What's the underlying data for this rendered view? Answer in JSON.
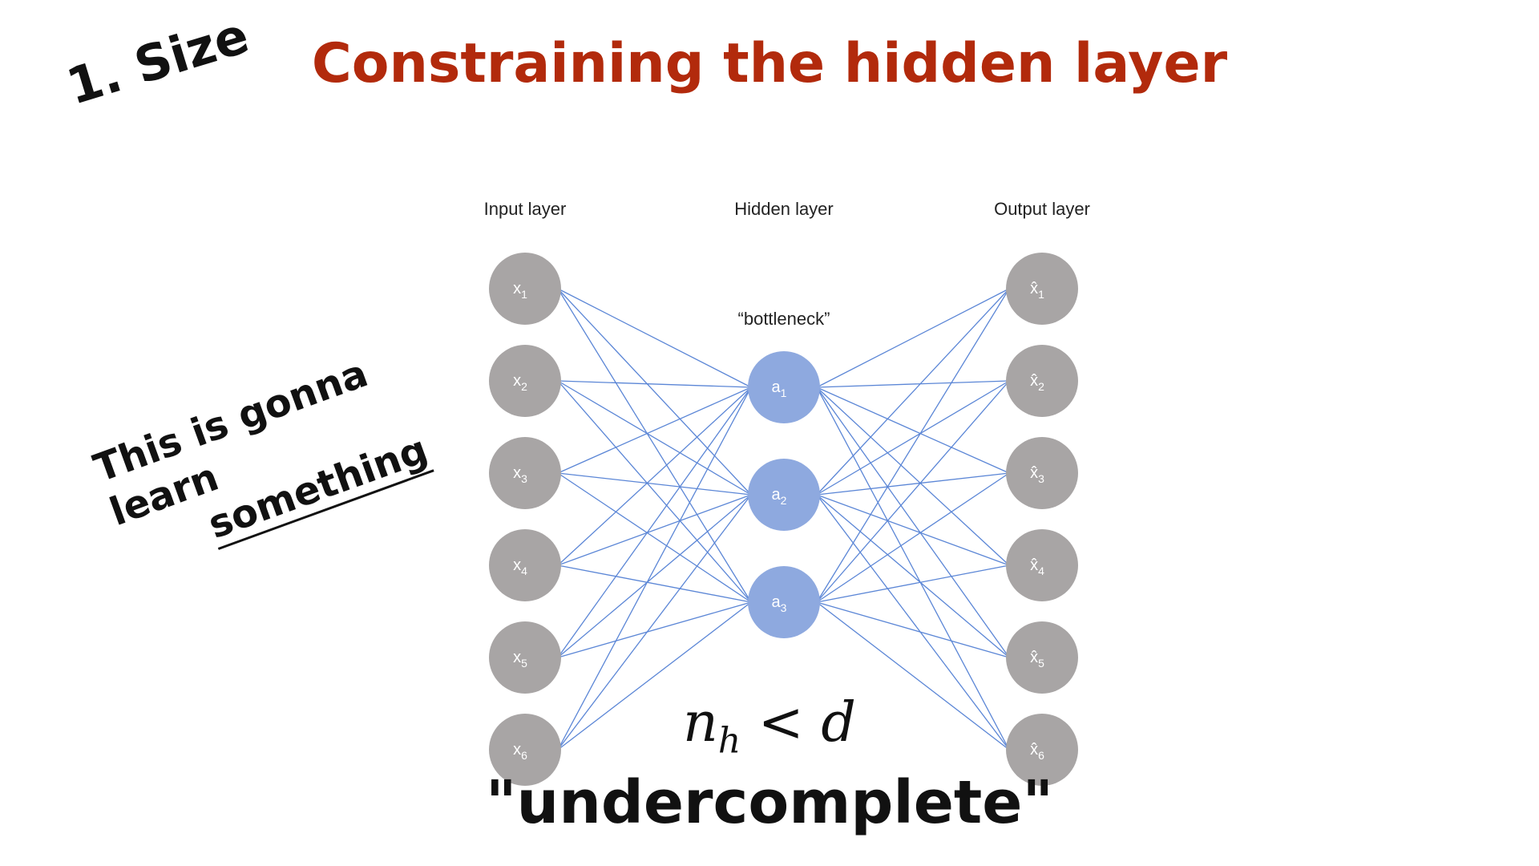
{
  "title": "Constraining the hidden layer",
  "section_label": "1. Size",
  "note": {
    "line1": "This is gonna learn",
    "line2": "something"
  },
  "layers": {
    "input": {
      "label": "Input layer",
      "nodes": [
        "x",
        "x",
        "x",
        "x",
        "x",
        "x"
      ],
      "subscripts": [
        "1",
        "2",
        "3",
        "4",
        "5",
        "6"
      ]
    },
    "hidden": {
      "label": "Hidden layer",
      "annotation": "“bottleneck”",
      "nodes": [
        "a",
        "a",
        "a"
      ],
      "subscripts": [
        "1",
        "2",
        "3"
      ]
    },
    "output": {
      "label": "Output layer",
      "nodes": [
        "x̂",
        "x̂",
        "x̂",
        "x̂",
        "x̂",
        "x̂"
      ],
      "subscripts": [
        "1",
        "2",
        "3",
        "4",
        "5",
        "6"
      ]
    }
  },
  "formula": {
    "lhs": "n",
    "lhs_sub": "h",
    "op": " < ",
    "rhs": "d"
  },
  "caption": "\"undercomplete\"",
  "colors": {
    "title": "#b22a0c",
    "input_node": "#a8a5a5",
    "hidden_node": "#8ea9df",
    "edge": "#5b86d6"
  }
}
